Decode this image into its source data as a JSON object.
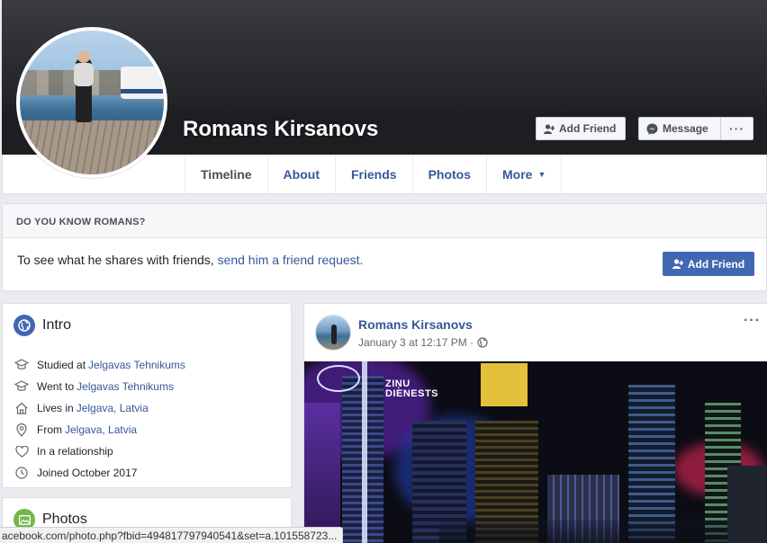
{
  "profile": {
    "name": "Romans Kirsanovs"
  },
  "cover_actions": {
    "add_friend": "Add Friend",
    "message": "Message",
    "more": "···"
  },
  "nav": {
    "items": [
      {
        "label": "Timeline"
      },
      {
        "label": "About"
      },
      {
        "label": "Friends"
      },
      {
        "label": "Photos"
      },
      {
        "label": "More"
      }
    ]
  },
  "know": {
    "heading": "DO YOU KNOW ROMANS?",
    "prefix": "To see what he shares with friends, ",
    "link": "send him a friend request.",
    "button": "Add Friend"
  },
  "intro": {
    "title": "Intro",
    "items": [
      {
        "icon": "graduation-cap-icon",
        "prefix": "Studied at",
        "link": "Jelgavas Tehnikums"
      },
      {
        "icon": "graduation-cap-icon",
        "prefix": "Went to",
        "link": "Jelgavas Tehnikums"
      },
      {
        "icon": "home-icon",
        "prefix": "Lives in",
        "link": "Jelgava, Latvia"
      },
      {
        "icon": "location-pin-icon",
        "prefix": "From",
        "link": "Jelgava, Latvia"
      },
      {
        "icon": "heart-icon",
        "prefix": "In a relationship",
        "link": ""
      },
      {
        "icon": "clock-icon",
        "prefix": "Joined October 2017",
        "link": ""
      }
    ]
  },
  "photos": {
    "title": "Photos"
  },
  "post": {
    "author": "Romans Kirsanovs",
    "date": "January 3 at 12:17 PM · ",
    "menu": "···",
    "image_text_line1": "ZIŅU",
    "image_text_line2": "DIENESTS"
  },
  "statusbar": {
    "url": "acebook.com/photo.php?fbid=494817797940541&set=a.101558723..."
  },
  "colors": {
    "link": "#365899",
    "primary_button": "#4267b2",
    "page_bg": "#e9ebee",
    "photos_badge": "#71b84a"
  }
}
